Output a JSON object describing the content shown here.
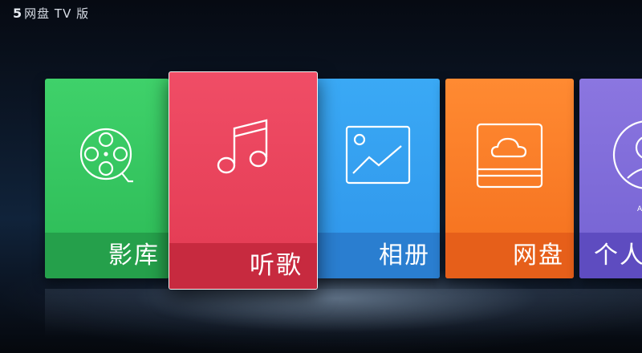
{
  "app": {
    "logo": "5",
    "title": "网盘 TV 版"
  },
  "tiles": [
    {
      "label": "影库"
    },
    {
      "label": "听歌"
    },
    {
      "label": "相册"
    },
    {
      "label": "网盘"
    },
    {
      "label": "个人",
      "small_text": "A"
    }
  ],
  "colors": {
    "movies": "#2cba56",
    "music": "#e23a52",
    "photos": "#2f95ea",
    "cloud": "#f46f1d",
    "profile": "#7462d2"
  },
  "icons": [
    "film-reel-icon",
    "music-note-icon",
    "photo-icon",
    "cloud-drive-icon",
    "user-avatar-icon"
  ]
}
